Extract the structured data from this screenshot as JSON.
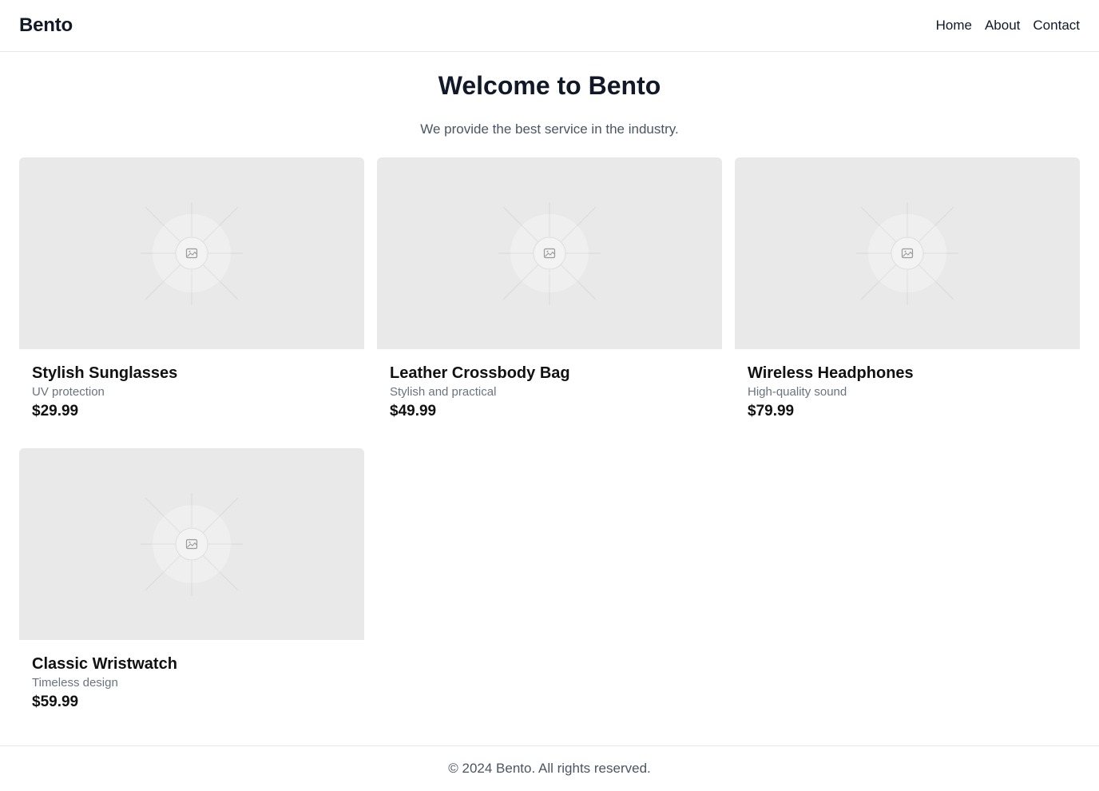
{
  "header": {
    "brand": "Bento",
    "nav": [
      "Home",
      "About",
      "Contact"
    ]
  },
  "hero": {
    "title": "Welcome to Bento",
    "subtitle": "We provide the best service in the industry."
  },
  "products": [
    {
      "title": "Stylish Sunglasses",
      "subtitle": "UV protection",
      "price": "$29.99",
      "image_icon": "image-placeholder-icon"
    },
    {
      "title": "Leather Crossbody Bag",
      "subtitle": "Stylish and practical",
      "price": "$49.99",
      "image_icon": "image-placeholder-icon"
    },
    {
      "title": "Wireless Headphones",
      "subtitle": "High-quality sound",
      "price": "$79.99",
      "image_icon": "image-placeholder-icon"
    },
    {
      "title": "Classic Wristwatch",
      "subtitle": "Timeless design",
      "price": "$59.99",
      "image_icon": "image-placeholder-icon"
    }
  ],
  "footer": {
    "text": "© 2024 Bento. All rights reserved."
  },
  "colors": {
    "text": "#111827",
    "muted": "#6b7280",
    "placeholder_bg": "#e9e9e9",
    "border": "#e5e7eb"
  }
}
